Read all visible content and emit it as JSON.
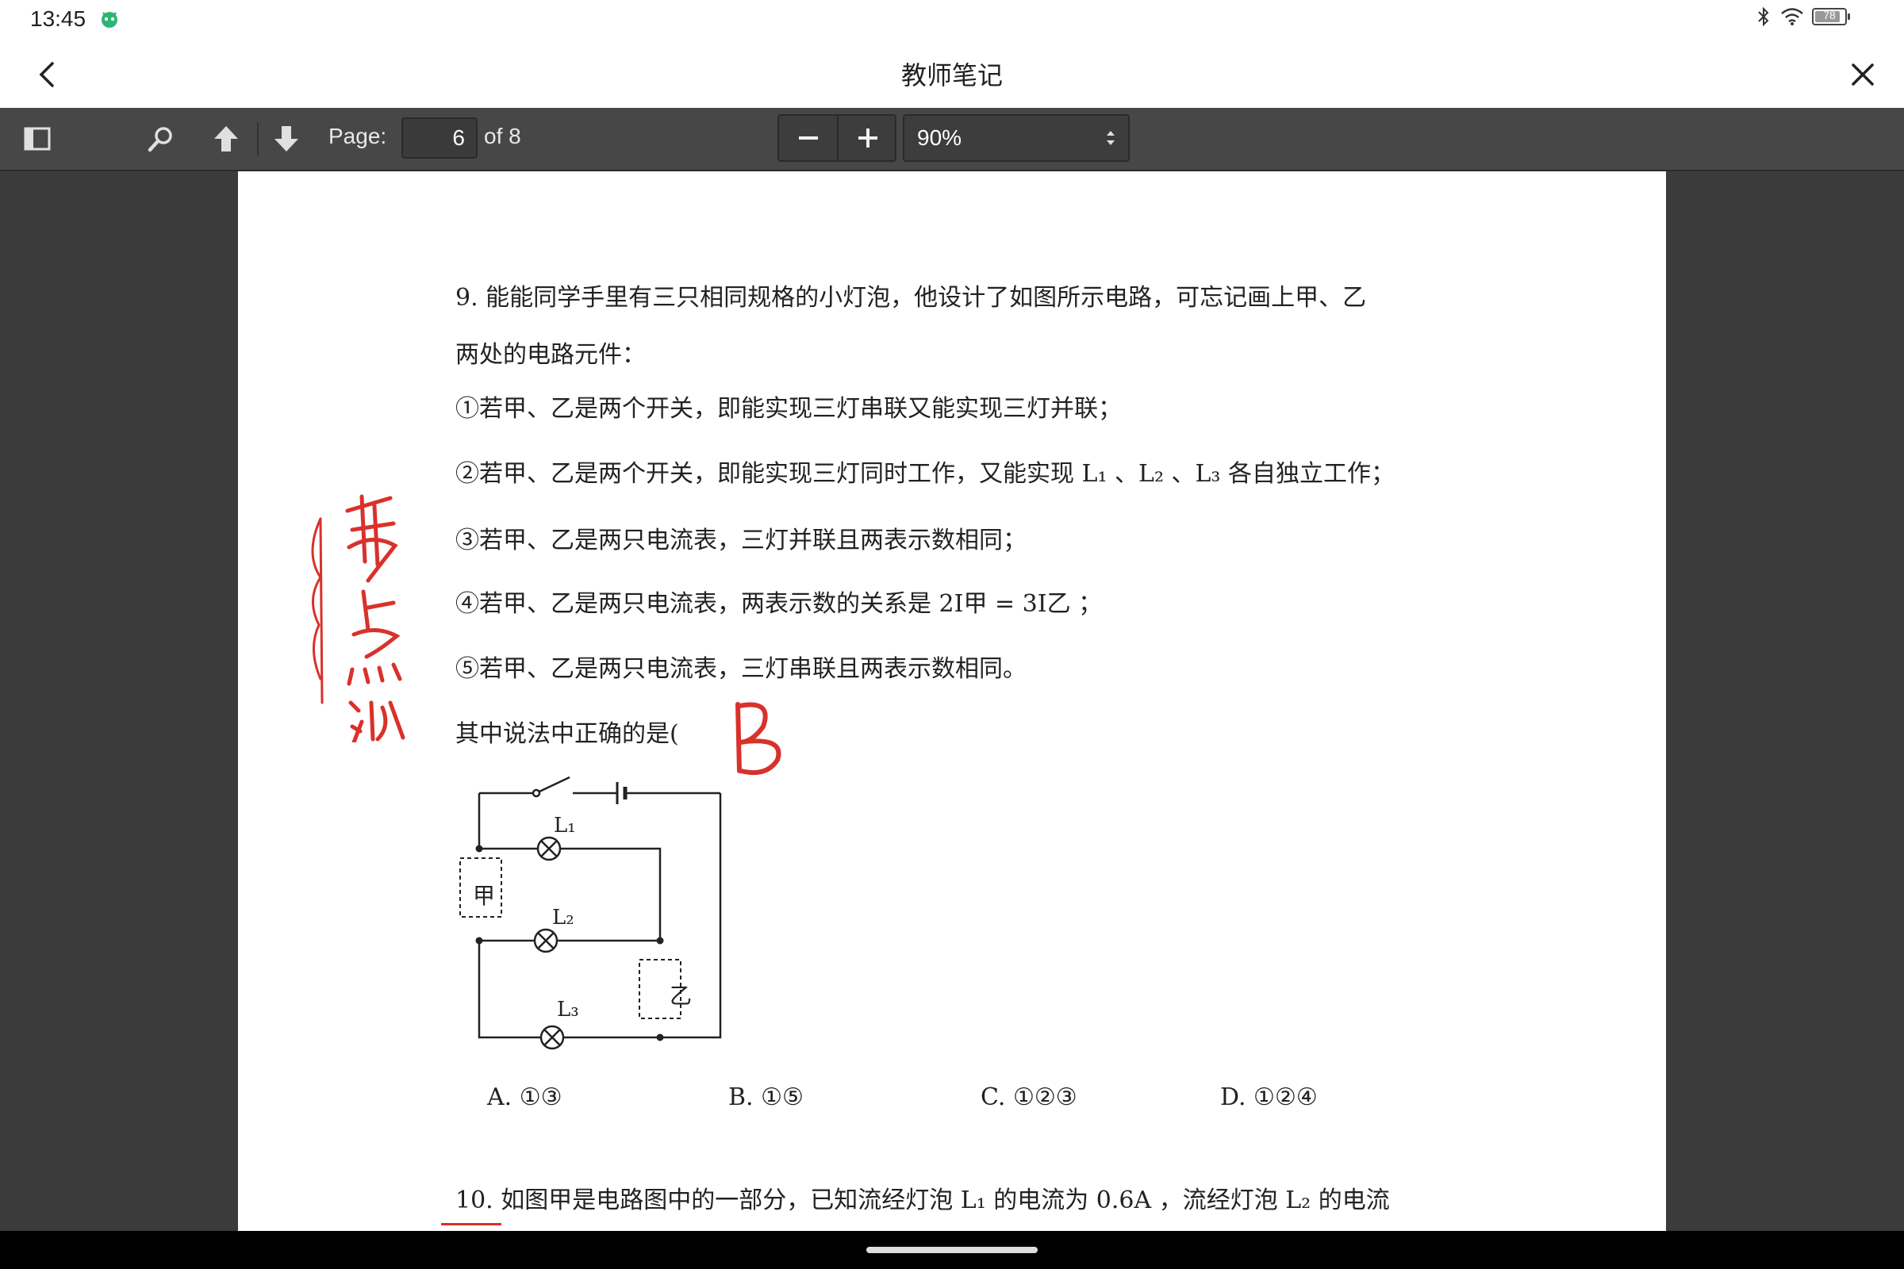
{
  "status": {
    "time": "13:45",
    "battery_level": "78",
    "icons": [
      "bluetooth-icon",
      "wifi-icon",
      "battery-icon"
    ]
  },
  "header": {
    "title": "教师笔记"
  },
  "toolbar": {
    "page_label": "Page:",
    "page_value": "6",
    "page_of": "of 8",
    "zoom_minus": "−",
    "zoom_plus": "+",
    "zoom_value": "90%"
  },
  "document": {
    "question9": {
      "stem_line1": "9. 能能同学手里有三只相同规格的小灯泡，他设计了如图所示电路，可忘记画上甲、乙",
      "stem_line2": "两处的电路元件：",
      "s1": "①若甲、乙是两个开关，即能实现三灯串联又能实现三灯并联；",
      "s2": "②若甲、乙是两个开关，即能实现三灯同时工作，又能实现 L₁ 、L₂ 、L₃ 各自独立工作；",
      "s3": "③若甲、乙是两只电流表，三灯并联且两表示数相同；",
      "s4": "④若甲、乙是两只电流表，两表示数的关系是 2I甲 = 3I乙 ；",
      "s5": "⑤若甲、乙是两只电流表，三灯串联且两表示数相同。",
      "prompt": "其中说法中正确的是(",
      "circuit": {
        "box_jia": "甲",
        "box_yi": "乙",
        "l1": "L₁",
        "l2": "L₂",
        "l3": "L₃"
      },
      "options": [
        "A. ①③",
        "B. ①⑤",
        "C. ①②③",
        "D. ①②④"
      ]
    },
    "question10": {
      "line1": "10. 如图甲是电路图中的一部分，已知流经灯泡 L₁ 的电流为 0.6A ，流经灯泡 L₂ 的电流"
    },
    "handwriting_ink_color": "#d9312b"
  }
}
